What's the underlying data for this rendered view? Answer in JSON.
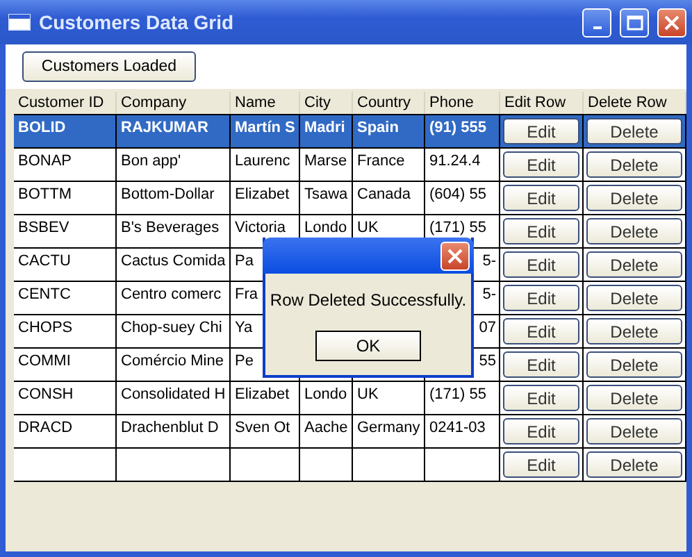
{
  "window": {
    "title": "Customers Data Grid"
  },
  "toolbar": {
    "button": "Customers Loaded"
  },
  "grid": {
    "columns": [
      "Customer ID",
      "Company",
      "Name",
      "City",
      "Country",
      "Phone",
      "Edit Row",
      "Delete Row"
    ],
    "rows": [
      {
        "selected": true,
        "customer_id": "BOLID",
        "company": "RAJKUMAR",
        "name": "Martín S",
        "city": "Madri",
        "country": "Spain",
        "phone": "(91) 555",
        "phone_cut_left": false,
        "edit": "Edit",
        "delete": "Delete"
      },
      {
        "selected": false,
        "customer_id": "BONAP",
        "company": "Bon app'",
        "name": "Laurenc",
        "city": "Marse",
        "country": "France",
        "phone": "91.24.4",
        "phone_cut_left": false,
        "edit": "Edit",
        "delete": "Delete"
      },
      {
        "selected": false,
        "customer_id": "BOTTM",
        "company": "Bottom-Dollar",
        "name": "Elizabet",
        "city": "Tsawa",
        "country": "Canada",
        "phone": "(604) 55",
        "phone_cut_left": false,
        "edit": "Edit",
        "delete": "Delete"
      },
      {
        "selected": false,
        "customer_id": "BSBEV",
        "company": "B's Beverages",
        "name": "Victoria",
        "city": "Londo",
        "country": "UK",
        "phone": "(171) 55",
        "phone_cut_left": false,
        "edit": "Edit",
        "delete": "Delete"
      },
      {
        "selected": false,
        "customer_id": "CACTU",
        "company": "Cactus Comida",
        "name": "Pa",
        "phone": "5-",
        "phone_cut_left": true,
        "edit": "Edit",
        "delete": "Delete"
      },
      {
        "selected": false,
        "customer_id": "CENTC",
        "company": "Centro comerc",
        "name": "Fra",
        "phone": "5-",
        "phone_cut_left": true,
        "edit": "Edit",
        "delete": "Delete"
      },
      {
        "selected": false,
        "customer_id": "CHOPS",
        "company": "Chop-suey Chi",
        "name": "Ya",
        "phone": "07",
        "phone_cut_left": true,
        "edit": "Edit",
        "delete": "Delete"
      },
      {
        "selected": false,
        "customer_id": "COMMI",
        "company": "Comércio Mine",
        "name": "Pe",
        "phone": "55",
        "phone_cut_left": true,
        "edit": "Edit",
        "delete": "Delete"
      },
      {
        "selected": false,
        "customer_id": "CONSH",
        "company": "Consolidated H",
        "name": "Elizabet",
        "city": "Londo",
        "country": "UK",
        "phone": "(171) 55",
        "phone_cut_left": false,
        "edit": "Edit",
        "delete": "Delete"
      },
      {
        "selected": false,
        "customer_id": "DRACD",
        "company": "Drachenblut D",
        "name": "Sven Ot",
        "city": "Aache",
        "country": "Germany",
        "phone": "0241-03",
        "phone_cut_left": false,
        "edit": "Edit",
        "delete": "Delete"
      },
      {
        "selected": false,
        "edit": "Edit",
        "delete": "Delete"
      }
    ]
  },
  "dialog": {
    "message": "Row Deleted Successfully.",
    "button": "OK"
  }
}
